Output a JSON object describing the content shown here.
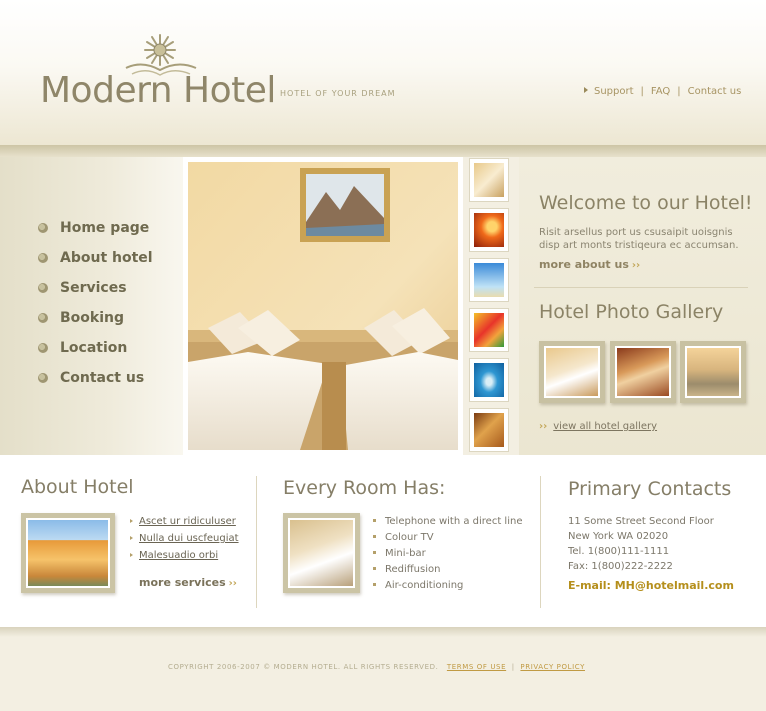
{
  "header": {
    "logo_text": "Modern Hotel",
    "tagline": "HOTEL OF YOUR DREAM",
    "links": [
      "Support",
      "FAQ",
      "Contact us"
    ]
  },
  "nav": {
    "items": [
      "Home page",
      "About hotel",
      "Services",
      "Booking",
      "Location",
      "Contact us"
    ]
  },
  "welcome": {
    "title": "Welcome to our Hotel!",
    "text": "Risit arsellus port us csusaipit uoisgnis disp art monts tristiqeura ec accumsan.",
    "more_label": "more about us"
  },
  "gallery": {
    "title": "Hotel Photo Gallery",
    "view_all_label": "view all hotel gallery"
  },
  "about": {
    "title": "About Hotel",
    "links": [
      "Ascet ur ridiculuser",
      "Nulla dui uscfeugiat",
      "Malesuadio orbi"
    ],
    "more_label": "more services"
  },
  "rooms": {
    "title": "Every Room Has:",
    "amenities": [
      "Telephone with a direct line",
      "Colour TV",
      "Mini-bar",
      "Rediffusion",
      "Air-conditioning"
    ]
  },
  "contacts": {
    "title": "Primary Contacts",
    "address1": "11 Some Street Second Floor",
    "address2": "New York WA 02020",
    "tel": "Tel.  1(800)111-1111",
    "fax": "Fax: 1(800)222-2222",
    "email": "E-mail: MH@hotelmail.com"
  },
  "footer": {
    "copyright": "COPYRIGHT 2006-2007 © MODERN HOTEL. ALL RIGHTS RESERVED.",
    "terms_label": "TERMS OF USE",
    "privacy_label": "PRIVACY POLICY",
    "separator": "|"
  },
  "colors": {
    "accent_gold": "#b58f1c",
    "text_olive": "#857e67",
    "frame_tan": "#cbc4a5"
  }
}
